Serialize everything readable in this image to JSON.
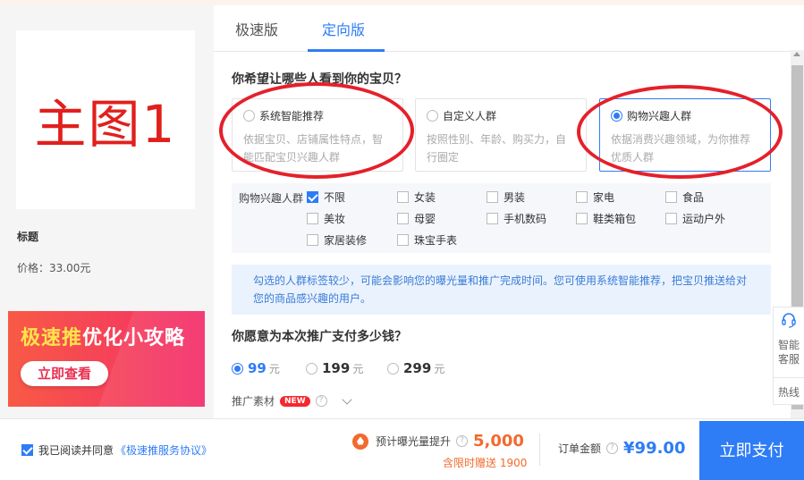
{
  "left": {
    "main_image_text": "主图1",
    "title": "标题",
    "price": "价格：33.00元",
    "banner": {
      "title_part1": "极速推",
      "title_part2": "优化小攻略",
      "button": "立即查看"
    }
  },
  "tabs": [
    {
      "label": "极速版",
      "active": false
    },
    {
      "label": "定向版",
      "active": true
    }
  ],
  "audience": {
    "question": "你希望让哪些人看到你的宝贝？",
    "options": [
      {
        "label": "系统智能推荐",
        "desc": "依据宝贝、店铺属性特点，智能匹配宝贝兴趣人群",
        "selected": false
      },
      {
        "label": "自定义人群",
        "desc": "按照性别、年龄、购买力，自行圈定",
        "selected": false
      },
      {
        "label": "购物兴趣人群",
        "desc": "依据消费兴趣领域，为你推荐优质人群",
        "selected": true
      }
    ]
  },
  "interest": {
    "label": "购物兴趣人群",
    "items": [
      {
        "label": "不限",
        "checked": true
      },
      {
        "label": "女装",
        "checked": false
      },
      {
        "label": "男装",
        "checked": false
      },
      {
        "label": "家电",
        "checked": false
      },
      {
        "label": "食品",
        "checked": false
      },
      {
        "label": "美妆",
        "checked": false
      },
      {
        "label": "母婴",
        "checked": false
      },
      {
        "label": "手机数码",
        "checked": false
      },
      {
        "label": "鞋类箱包",
        "checked": false
      },
      {
        "label": "运动户外",
        "checked": false
      },
      {
        "label": "家居装修",
        "checked": false
      },
      {
        "label": "珠宝手表",
        "checked": false
      }
    ]
  },
  "notice": "勾选的人群标签较少，可能会影响您的曝光量和推广完成时间。您可使用系统智能推荐，把宝贝推送给对您的商品感兴趣的用户。",
  "payment": {
    "question": "你愿意为本次推广支付多少钱？",
    "options": [
      {
        "amount": "99",
        "unit": "元",
        "selected": true
      },
      {
        "amount": "199",
        "unit": "元",
        "selected": false
      },
      {
        "amount": "299",
        "unit": "元",
        "selected": false
      }
    ]
  },
  "material": {
    "label": "推广素材",
    "badge": "NEW",
    "help": "?"
  },
  "side_service": {
    "service_label": "智能客服",
    "hotline_label": "热线"
  },
  "bottom": {
    "agree_prefix": "我已阅读并同意",
    "agree_link": "《极速推服务协议》",
    "estimate_label": "预计曝光量提升",
    "estimate_value": "5,000",
    "gift_text": "含限时赠送 1900",
    "order_label": "订单金额",
    "order_value": "¥99.00",
    "pay_button": "立即支付"
  },
  "colors": {
    "accent": "#2e7cf6",
    "annotation": "#e5202a",
    "highlight": "#f26a2d"
  }
}
